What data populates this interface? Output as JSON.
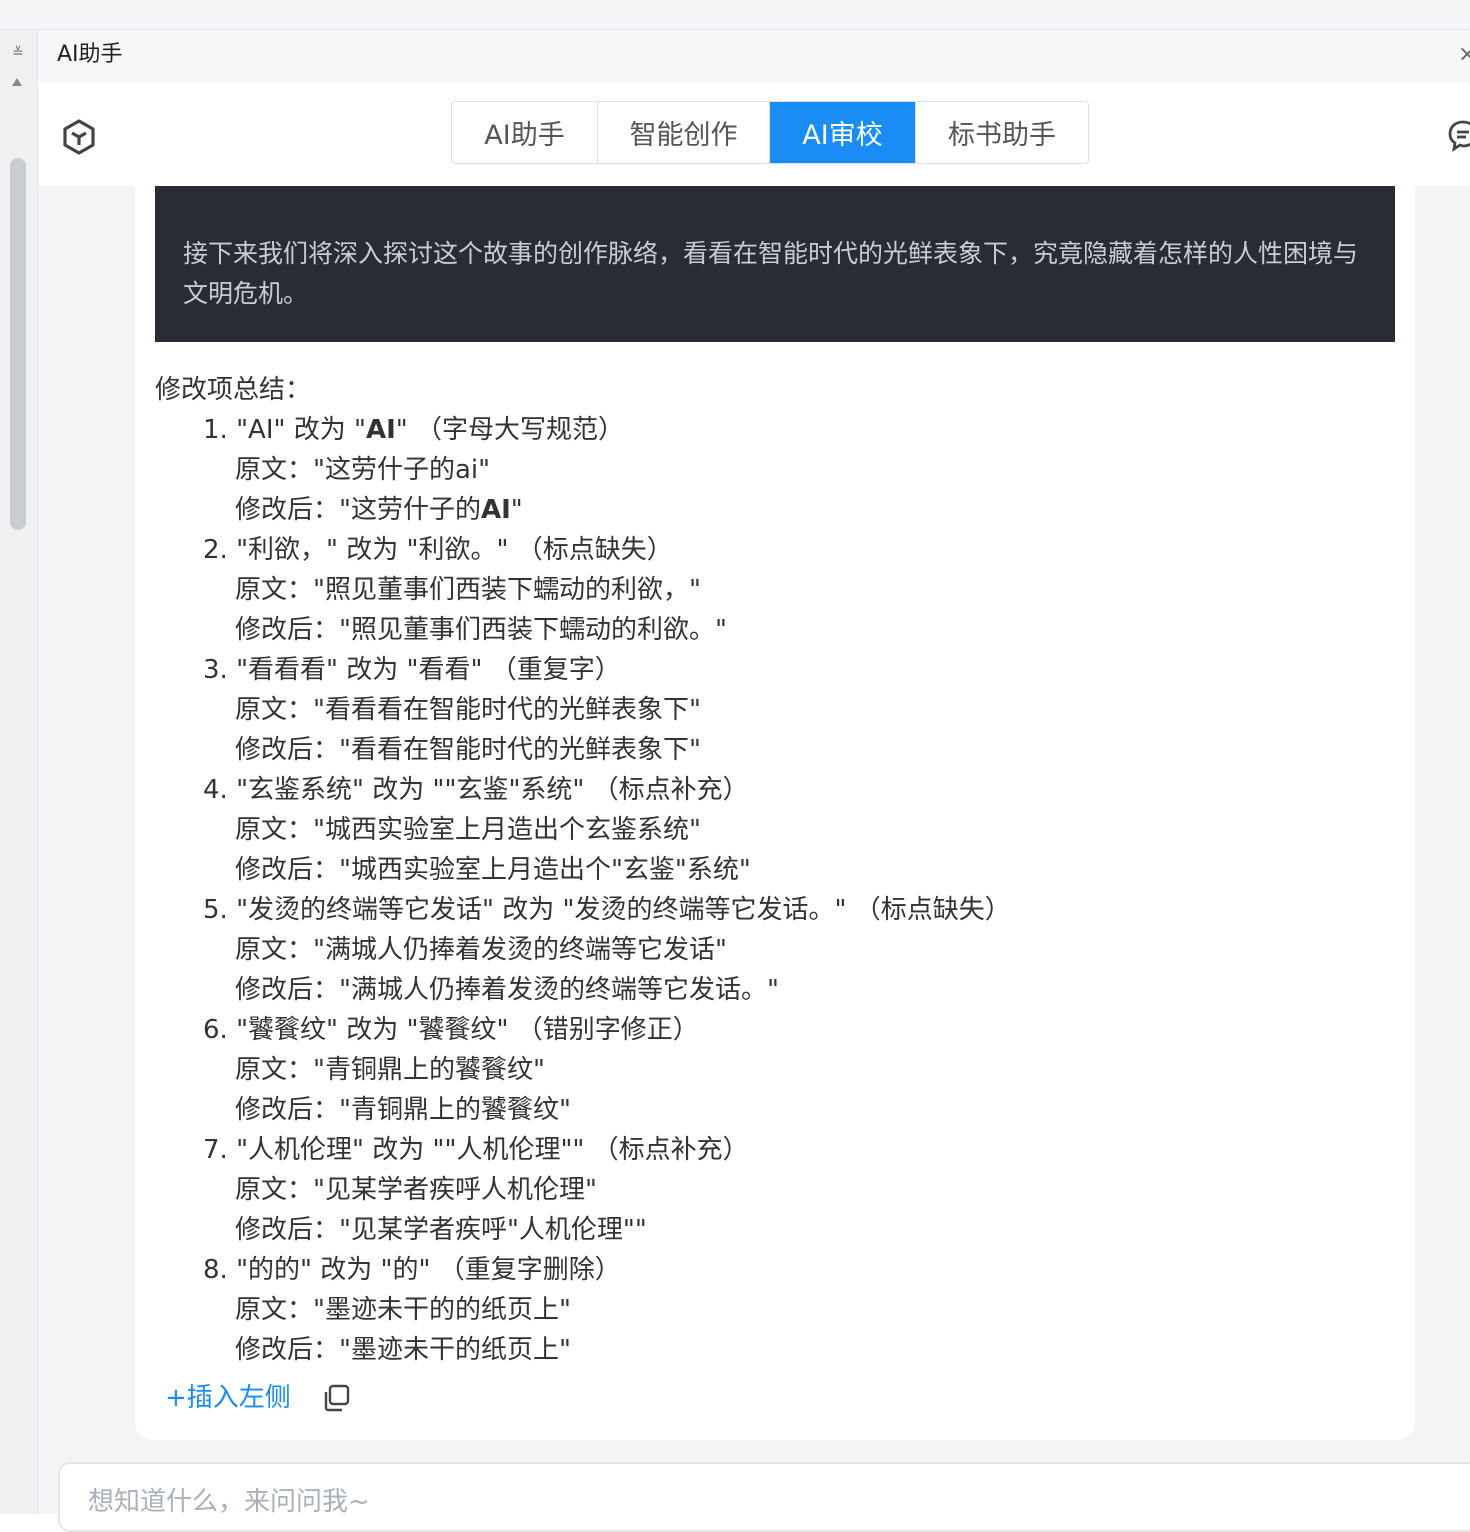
{
  "panel": {
    "title": "AI助手",
    "close": "×"
  },
  "tabs": [
    {
      "label": "AI助手",
      "active": false
    },
    {
      "label": "智能创作",
      "active": false
    },
    {
      "label": "AI审校",
      "active": true
    },
    {
      "label": "标书助手",
      "active": false
    }
  ],
  "code_block": {
    "text": "接下来我们将深入探讨这个故事的创作脉络，看看在智能时代的光鲜表象下，究竟隐藏着怎样的人性困境与文明危机。"
  },
  "summary": {
    "title": "修改项总结：",
    "original_label": "原文：",
    "revised_label": "修改后：",
    "items": [
      {
        "num": "1.",
        "from": "\"AI\"",
        "to_prefix": "\"",
        "to_bold": "AI",
        "to_suffix": "\"",
        "reason": "（字母大写规范）",
        "original": "\"这劳什子的ai\"",
        "revised_prefix": "\"这劳什子的",
        "revised_bold": "AI",
        "revised_suffix": "\""
      },
      {
        "num": "2.",
        "from": "\"利欲，\"",
        "to": "\"利欲。\"",
        "reason": "（标点缺失）",
        "original": "\"照见董事们西装下蠕动的利欲，\"",
        "revised": "\"照见董事们西装下蠕动的利欲。\""
      },
      {
        "num": "3.",
        "from": "\"看看看\"",
        "to": "\"看看\"",
        "reason": "（重复字）",
        "original": "\"看看看在智能时代的光鲜表象下\"",
        "revised": "\"看看在智能时代的光鲜表象下\""
      },
      {
        "num": "4.",
        "from": "\"玄鉴系统\"",
        "to": "\"\"玄鉴\"系统\"",
        "reason": "（标点补充）",
        "original": "\"城西实验室上月造出个玄鉴系统\"",
        "revised": "\"城西实验室上月造出个\"玄鉴\"系统\""
      },
      {
        "num": "5.",
        "from": "\"发烫的终端等它发话\"",
        "to": "\"发烫的终端等它发话。\"",
        "reason": "（标点缺失）",
        "original": "\"满城人仍捧着发烫的终端等它发话\"",
        "revised": "\"满城人仍捧着发烫的终端等它发话。\""
      },
      {
        "num": "6.",
        "from": "\"饕餮纹\"",
        "to": "\"饕餮纹\"",
        "reason": "（错别字修正）",
        "original": "\"青铜鼎上的饕餮纹\"",
        "revised": "\"青铜鼎上的饕餮纹\""
      },
      {
        "num": "7.",
        "from": "\"人机伦理\"",
        "to": "\"\"人机伦理\"\"",
        "reason": "（标点补充）",
        "original": "\"见某学者疾呼人机伦理\"",
        "revised": "\"见某学者疾呼\"人机伦理\"\""
      },
      {
        "num": "8.",
        "from": "\"的的\"",
        "to": "\"的\"",
        "reason": "（重复字删除）",
        "original": "\"墨迹未干的的纸页上\"",
        "revised": "\"墨迹未干的纸页上\""
      }
    ],
    "change_word": "改为"
  },
  "actions": {
    "insert_label": "+插入左侧"
  },
  "input": {
    "placeholder": "想知道什么，来问问我~"
  },
  "colors": {
    "accent": "#1a8cf5",
    "code_bg": "#282c34"
  }
}
